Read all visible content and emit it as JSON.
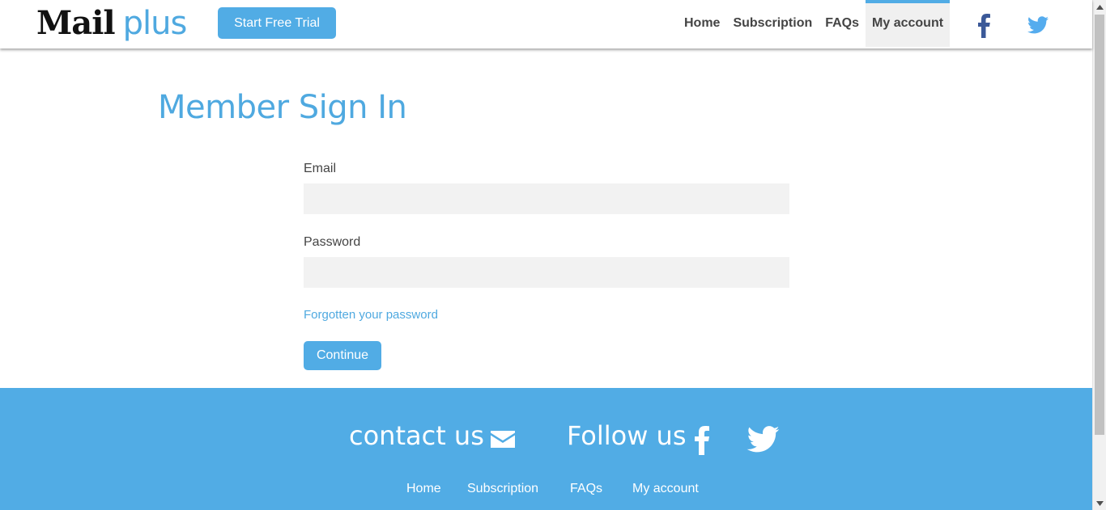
{
  "header": {
    "logo_mail": "Mail",
    "logo_plus": "plus",
    "trial_button": "Start Free Trial",
    "nav": [
      {
        "label": "Home"
      },
      {
        "label": "Subscription"
      },
      {
        "label": "FAQs"
      },
      {
        "label": "My account",
        "active": true
      }
    ],
    "social_icons": [
      "facebook-icon",
      "twitter-icon"
    ]
  },
  "main": {
    "title": "Member Sign In",
    "email_label": "Email",
    "email_value": "",
    "password_label": "Password",
    "password_value": "",
    "forgot_link": "Forgotten your password",
    "continue_button": "Continue"
  },
  "footer": {
    "contact": "contact us",
    "follow": "Follow us",
    "links": [
      {
        "label": "Home"
      },
      {
        "label": "Subscription"
      },
      {
        "label": "FAQs"
      },
      {
        "label": "My account"
      }
    ]
  },
  "colors": {
    "accent": "#51ace5",
    "title_blue": "#4fa9e0",
    "facebook": "#3b5998",
    "twitter": "#55acee",
    "input_bg": "#f2f2f2"
  }
}
